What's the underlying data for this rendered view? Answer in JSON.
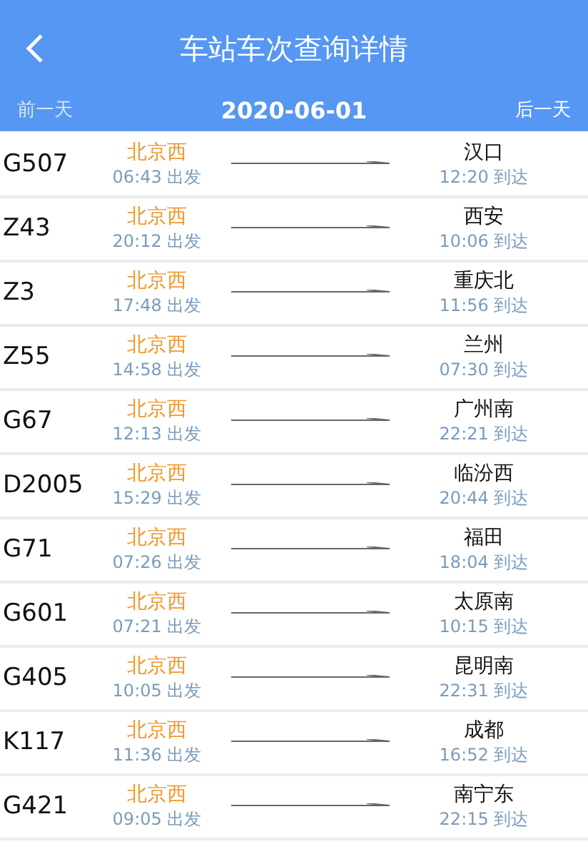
{
  "header": {
    "title": "车站车次查询详情"
  },
  "date_bar": {
    "prev": {
      "label": "前一天",
      "disabled": true
    },
    "date": "2020-06-01",
    "next": {
      "label": "后一天",
      "disabled": false
    }
  },
  "trains": [
    {
      "number": "G507",
      "from": "北京西",
      "depart": "06:43 出发",
      "to": "汉口",
      "arrive": "12:20 到达"
    },
    {
      "number": "Z43",
      "from": "北京西",
      "depart": "20:12 出发",
      "to": "西安",
      "arrive": "10:06 到达"
    },
    {
      "number": "Z3",
      "from": "北京西",
      "depart": "17:48 出发",
      "to": "重庆北",
      "arrive": "11:56 到达"
    },
    {
      "number": "Z55",
      "from": "北京西",
      "depart": "14:58 出发",
      "to": "兰州",
      "arrive": "07:30 到达"
    },
    {
      "number": "G67",
      "from": "北京西",
      "depart": "12:13 出发",
      "to": "广州南",
      "arrive": "22:21 到达"
    },
    {
      "number": "D2005",
      "from": "北京西",
      "depart": "15:29 出发",
      "to": "临汾西",
      "arrive": "20:44 到达"
    },
    {
      "number": "G71",
      "from": "北京西",
      "depart": "07:26 出发",
      "to": "福田",
      "arrive": "18:04 到达"
    },
    {
      "number": "G601",
      "from": "北京西",
      "depart": "07:21 出发",
      "to": "太原南",
      "arrive": "10:15 到达"
    },
    {
      "number": "G405",
      "from": "北京西",
      "depart": "10:05 出发",
      "to": "昆明南",
      "arrive": "22:31 到达"
    },
    {
      "number": "K117",
      "from": "北京西",
      "depart": "11:36 出发",
      "to": "成都",
      "arrive": "16:52 到达"
    },
    {
      "number": "G421",
      "from": "北京西",
      "depart": "09:05 出发",
      "to": "南宁东",
      "arrive": "22:15 到达"
    }
  ]
}
